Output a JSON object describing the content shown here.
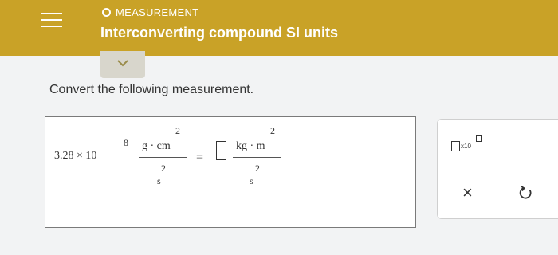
{
  "header": {
    "topic_label": "MEASUREMENT",
    "title": "Interconverting compound SI units"
  },
  "question": {
    "instruction": "Convert the following measurement."
  },
  "expression": {
    "coefficient": "3.28 × 10",
    "exponent": "8",
    "from_numerator": "g · cm",
    "from_numerator_exp": "2",
    "from_denominator": "s",
    "from_denominator_exp": "2",
    "equals": "=",
    "to_numerator": "kg · m",
    "to_numerator_exp": "2",
    "to_denominator": "s",
    "to_denominator_exp": "2"
  },
  "tools": {
    "x10_label": "x10",
    "clear_label": "×"
  },
  "icons": {
    "menu": "hamburger-menu-icon",
    "collapse": "chevron-down-icon",
    "undo": "undo-icon",
    "topic": "circle-icon"
  },
  "colors": {
    "header_bg": "#c9a227",
    "content_bg": "#f2f3f4"
  }
}
